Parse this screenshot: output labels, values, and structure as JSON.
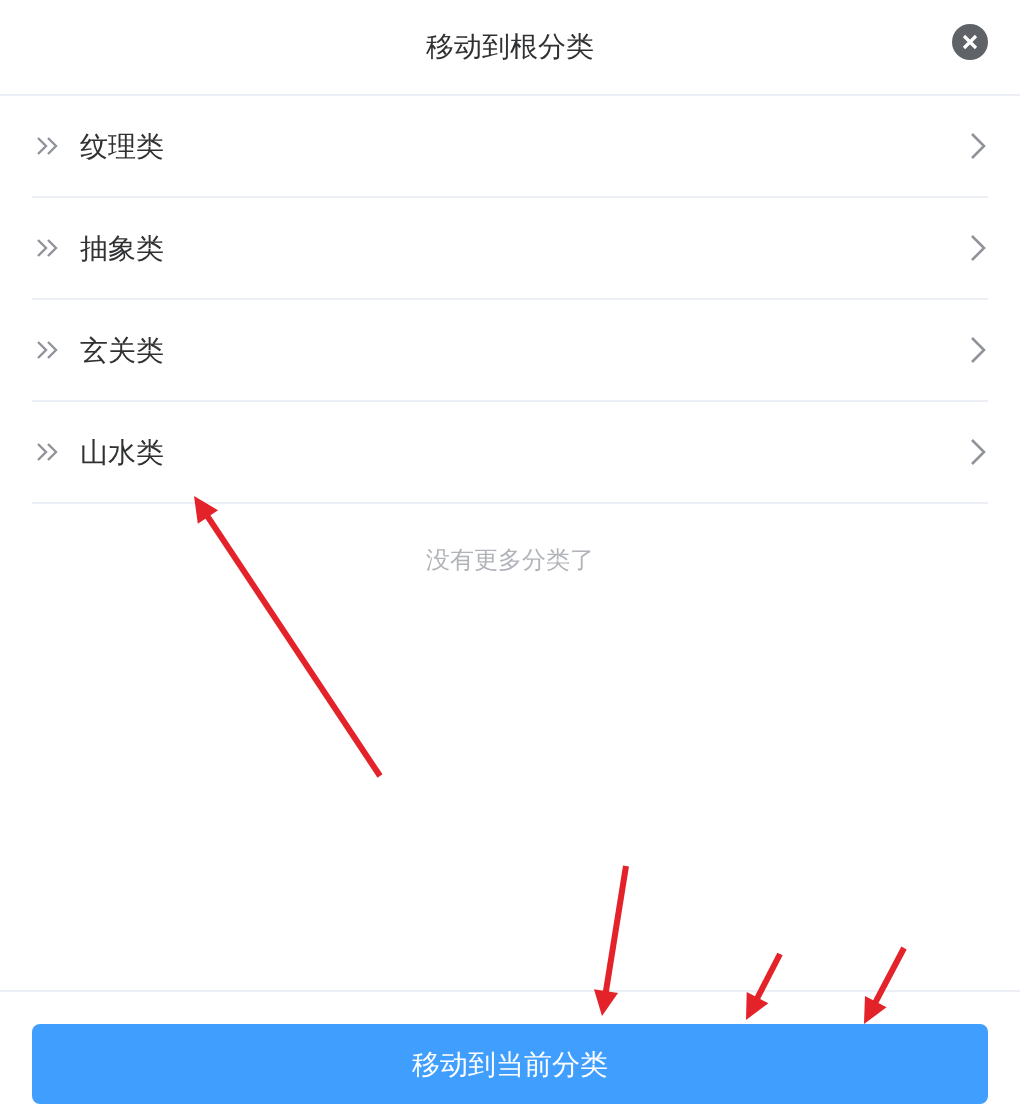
{
  "dialog": {
    "title": "移动到根分类"
  },
  "categories": [
    {
      "label": "纹理类"
    },
    {
      "label": "抽象类"
    },
    {
      "label": "玄关类"
    },
    {
      "label": "山水类"
    }
  ],
  "empty_note": "没有更多分类了",
  "confirm_button": "移动到当前分类"
}
